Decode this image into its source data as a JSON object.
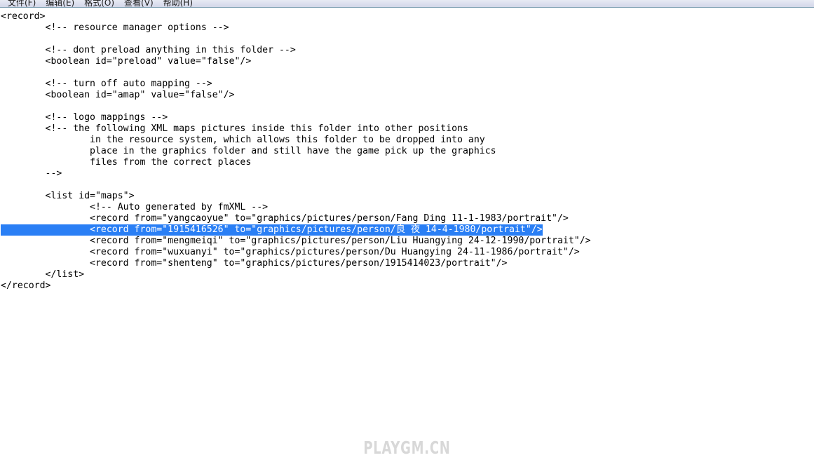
{
  "window": {
    "app": "notepad",
    "background_color": "#ffffff",
    "text_color": "#000000",
    "selection_color": "#2a7ff5",
    "selection_text_color": "#ffffff"
  },
  "menubar": {
    "items": [
      {
        "label": "文件(F)",
        "name": "menu-file"
      },
      {
        "label": "编辑(E)",
        "name": "menu-edit"
      },
      {
        "label": "格式(O)",
        "name": "menu-format"
      },
      {
        "label": "查看(V)",
        "name": "menu-view"
      },
      {
        "label": "帮助(H)",
        "name": "menu-help"
      }
    ]
  },
  "editor": {
    "lines": [
      {
        "text": "<record>",
        "selected": false
      },
      {
        "text": "        <!-- resource manager options -->",
        "selected": false
      },
      {
        "text": "",
        "selected": false
      },
      {
        "text": "        <!-- dont preload anything in this folder -->",
        "selected": false
      },
      {
        "text": "        <boolean id=\"preload\" value=\"false\"/>",
        "selected": false
      },
      {
        "text": "",
        "selected": false
      },
      {
        "text": "        <!-- turn off auto mapping -->",
        "selected": false
      },
      {
        "text": "        <boolean id=\"amap\" value=\"false\"/>",
        "selected": false
      },
      {
        "text": "",
        "selected": false
      },
      {
        "text": "        <!-- logo mappings -->",
        "selected": false
      },
      {
        "text": "        <!-- the following XML maps pictures inside this folder into other positions",
        "selected": false
      },
      {
        "text": "                in the resource system, which allows this folder to be dropped into any",
        "selected": false
      },
      {
        "text": "                place in the graphics folder and still have the game pick up the graphics",
        "selected": false
      },
      {
        "text": "                files from the correct places",
        "selected": false
      },
      {
        "text": "        -->",
        "selected": false
      },
      {
        "text": "",
        "selected": false
      },
      {
        "text": "        <list id=\"maps\">",
        "selected": false
      },
      {
        "text": "                <!-- Auto generated by fmXML -->",
        "selected": false
      },
      {
        "text": "                <record from=\"yangcaoyue\" to=\"graphics/pictures/person/Fang Ding 11-1-1983/portrait\"/>",
        "selected": false
      },
      {
        "text": "                <record from=\"1915416526\" to=\"graphics/pictures/person/良 夜 14-4-1980/portrait\"/>",
        "selected": true
      },
      {
        "text": "                <record from=\"mengmeiqi\" to=\"graphics/pictures/person/Liu Huangying 24-12-1990/portrait\"/>",
        "selected": false
      },
      {
        "text": "                <record from=\"wuxuanyi\" to=\"graphics/pictures/person/Du Huangying 24-11-1986/portrait\"/>",
        "selected": false
      },
      {
        "text": "                <record from=\"shenteng\" to=\"graphics/pictures/person/1915414023/portrait\"/>",
        "selected": false
      },
      {
        "text": "        </list>",
        "selected": false
      },
      {
        "text": "</record>",
        "selected": false
      }
    ]
  },
  "watermark": {
    "text": "PLAYGM.CN",
    "color": "#d8d8d8"
  }
}
